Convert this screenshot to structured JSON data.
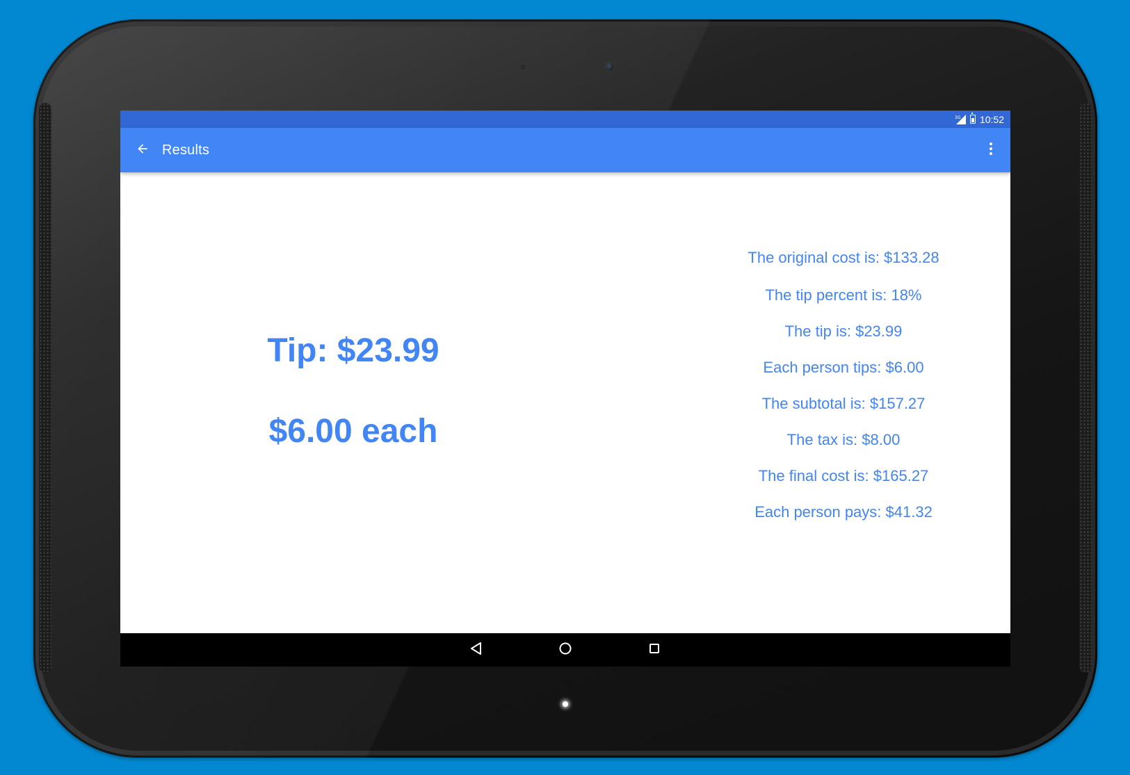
{
  "status_bar": {
    "network_label": "3G",
    "time": "10:52"
  },
  "app_bar": {
    "title": "Results",
    "back_icon": "arrow-back-icon",
    "menu_icon": "more-vert-icon"
  },
  "summary": {
    "tip_total": "Tip: $23.99",
    "tip_each": "$6.00 each"
  },
  "details": [
    "The original cost is: $133.28",
    "The tip percent is: 18%",
    "The tip is: $23.99",
    "Each person tips: $6.00",
    "The subtotal is: $157.27",
    "The tax is: $8.00",
    "The final cost is: $165.27",
    "Each person pays: $41.32"
  ],
  "nav_bar": {
    "back_icon": "triangle-back-icon",
    "home_icon": "circle-home-icon",
    "recents_icon": "square-recents-icon"
  },
  "colors": {
    "background": "#0288d1",
    "status_bar": "#3267d6",
    "app_bar": "#4285f4",
    "accent_text": "#4285f4",
    "nav_bar": "#000000"
  }
}
